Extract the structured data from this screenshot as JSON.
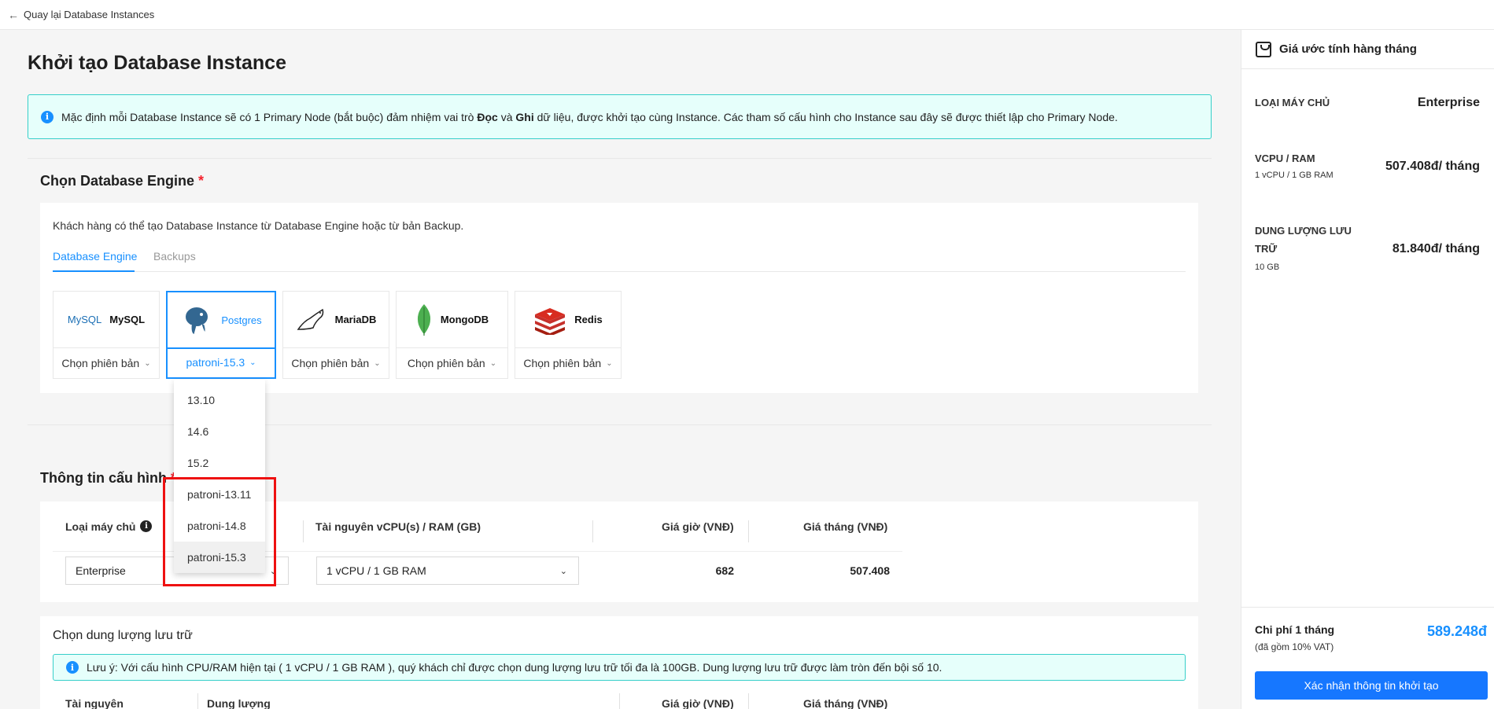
{
  "topbar": {
    "back_label": "Quay lại Database Instances"
  },
  "page": {
    "title": "Khởi tạo Database Instance"
  },
  "banner": {
    "text_1": "Mặc định mỗi Database Instance sẽ có 1 Primary Node (bắt buộc) đảm nhiệm vai trò ",
    "bold_1": "Đọc",
    "text_2": " và ",
    "bold_2": "Ghi",
    "text_3": " dữ liệu, được khởi tạo cùng Instance. Các tham số cấu hình cho Instance sau đây sẽ được thiết lập cho Primary Node."
  },
  "engine_section": {
    "title": "Chọn Database Engine",
    "required_mark": "*",
    "hint": "Khách hàng có thể tạo Database Instance từ Database Engine hoặc từ bản Backup.",
    "tabs": [
      {
        "label": "Database Engine",
        "active": true
      },
      {
        "label": "Backups",
        "active": false
      }
    ],
    "engines": [
      {
        "name": "MySQL",
        "version": "Chọn phiên bản",
        "selected": false
      },
      {
        "name": "Postgres",
        "version": "patroni-15.3",
        "selected": true
      },
      {
        "name": "MariaDB",
        "version": "Chọn phiên bản",
        "selected": false
      },
      {
        "name": "MongoDB",
        "version": "Chọn phiên bản",
        "selected": false
      },
      {
        "name": "Redis",
        "version": "Chọn phiên bản",
        "selected": false
      }
    ],
    "version_options": [
      "13.10",
      "14.6",
      "15.2",
      "patroni-13.11",
      "patroni-14.8",
      "patroni-15.3"
    ],
    "version_selected": "patroni-15.3",
    "logo_text": {
      "mysql": "MySQL"
    }
  },
  "config_section": {
    "title": "Thông tin cấu hình",
    "required_mark": "*",
    "headers": {
      "server_type": "Loại máy chủ",
      "resources": "Tài nguyên vCPU(s) / RAM (GB)",
      "hourly": "Giá giờ (VNĐ)",
      "monthly": "Giá tháng (VNĐ)"
    },
    "row": {
      "server_type": "Enterprise",
      "resources": "1 vCPU / 1 GB RAM",
      "hourly": "682",
      "monthly": "507.408"
    }
  },
  "storage_section": {
    "title": "Chọn dung lượng lưu trữ",
    "note": "Lưu ý: Với cấu hình CPU/RAM hiện tại ( 1 vCPU / 1 GB RAM ), quý khách chỉ được chọn dung lượng lưu trữ tối đa là 100GB. Dung lượng lưu trữ được làm tròn đến bội số 10.",
    "headers": {
      "resource": "Tài nguyên",
      "capacity": "Dung lượng",
      "hourly": "Giá giờ (VNĐ)",
      "monthly": "Giá tháng (VNĐ)"
    }
  },
  "sidebar": {
    "title": "Giá ước tính hàng tháng",
    "server_type": {
      "label": "LOẠI MÁY CHỦ",
      "value": "Enterprise"
    },
    "vcpu_ram": {
      "label": "VCPU / RAM",
      "sub": "1 vCPU / 1 GB RAM",
      "value": "507.408đ/ tháng"
    },
    "storage": {
      "label_1": "DUNG LƯỢNG LƯU",
      "label_2": "TRỮ",
      "sub": "10 GB",
      "value": "81.840đ/ tháng"
    },
    "total": {
      "label": "Chi phí 1 tháng",
      "sub": "(đã gồm 10% VAT)",
      "value": "589.248đ"
    },
    "confirm_label": "Xác nhận thông tin khởi tạo"
  },
  "colors": {
    "accent": "#1890ff",
    "required": "#f5222d",
    "banner_border": "#36cfc9",
    "highlight_box": "#ee1111"
  }
}
